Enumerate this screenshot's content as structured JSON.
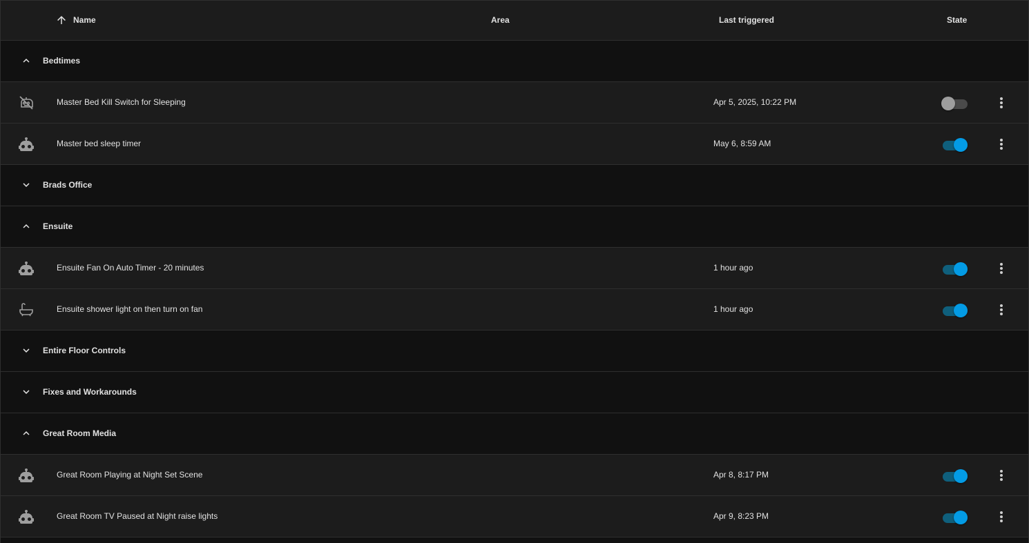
{
  "header": {
    "name": "Name",
    "area": "Area",
    "last_triggered": "Last triggered",
    "state": "State"
  },
  "groups": [
    {
      "label": "Bedtimes",
      "expanded": true,
      "rows": [
        {
          "icon": "robot-off-icon",
          "name": "Master Bed Kill Switch for Sleeping",
          "last": "Apr 5, 2025, 10:22 PM",
          "enabled": false
        },
        {
          "icon": "robot-icon",
          "name": "Master bed sleep timer",
          "last": "May 6, 8:59 AM",
          "enabled": true
        }
      ]
    },
    {
      "label": "Brads Office",
      "expanded": false,
      "rows": []
    },
    {
      "label": "Ensuite",
      "expanded": true,
      "rows": [
        {
          "icon": "robot-icon",
          "name": "Ensuite Fan On Auto Timer - 20 minutes",
          "last": "1 hour ago",
          "enabled": true
        },
        {
          "icon": "bathtub-icon",
          "name": "Ensuite shower light on then turn on fan",
          "last": "1 hour ago",
          "enabled": true
        }
      ]
    },
    {
      "label": "Entire Floor Controls",
      "expanded": false,
      "rows": []
    },
    {
      "label": "Fixes and Workarounds",
      "expanded": false,
      "rows": []
    },
    {
      "label": "Great Room Media",
      "expanded": true,
      "rows": [
        {
          "icon": "robot-icon",
          "name": "Great Room Playing at Night Set Scene",
          "last": "Apr 8, 8:17 PM",
          "enabled": true
        },
        {
          "icon": "robot-icon",
          "name": "Great Room TV Paused at Night raise lights",
          "last": "Apr 9, 8:23 PM",
          "enabled": true
        }
      ]
    }
  ],
  "colors": {
    "accent": "#039be5",
    "background": "#111111",
    "row_background": "#1c1c1c",
    "icon": "#9e9e9e"
  }
}
